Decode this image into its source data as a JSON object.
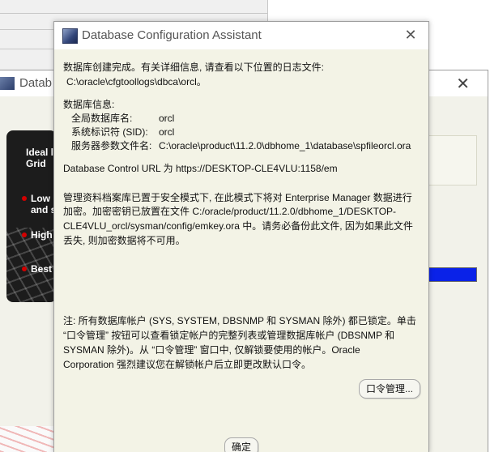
{
  "background": {
    "window_title": "Datab",
    "panel_text_line1": "Ideal l",
    "panel_text_line2": "Grid",
    "bullets": [
      "Low",
      "and s",
      "High",
      "Best"
    ],
    "accent_progress": "#0a22e8"
  },
  "dialog": {
    "title": "Database Configuration Assistant",
    "close_symbol": "✕",
    "intro_line1": "数据库创建完成。有关详细信息, 请查看以下位置的日志文件:",
    "log_path": "C:\\oracle\\cfgtoollogs\\dbca\\orcl。",
    "info_header": "数据库信息:",
    "info": [
      {
        "label": "全局数据库名:",
        "value": "orcl"
      },
      {
        "label": "系统标识符 (SID):",
        "value": "orcl"
      },
      {
        "label": "服务器参数文件名:",
        "value": "C:\\oracle\\product\\11.2.0\\dbhome_1\\database\\spfileorcl.ora"
      }
    ],
    "db_control_url": "Database Control URL 为 https://DESKTOP-CLE4VLU:1158/em",
    "repo_line1": "管理资料档案库已置于安全模式下, 在此模式下将对 Enterprise Manager 数据进行",
    "repo_line2": "加密。加密密钥已放置在文件 C:/oracle/product/11.2.0/dbhome_1/DESKTOP-",
    "repo_line3": "CLE4VLU_orcl/sysman/config/emkey.ora 中。请务必备份此文件, 因为如果此文件",
    "repo_line4": "丢失, 则加密数据将不可用。",
    "note_line1": "注: 所有数据库帐户 (SYS, SYSTEM, DBSNMP 和 SYSMAN 除外) 都已锁定。单击",
    "note_line2": "“口令管理” 按钮可以查看锁定帐户的完整列表或管理数据库帐户 (DBSNMP 和",
    "note_line3": "SYSMAN 除外)。从 “口令管理” 窗口中, 仅解锁要使用的帐户。Oracle",
    "note_line4": "Corporation 强烈建议您在解锁帐户后立即更改默认口令。",
    "password_button": "口令管理...",
    "ok_button": "确定"
  }
}
